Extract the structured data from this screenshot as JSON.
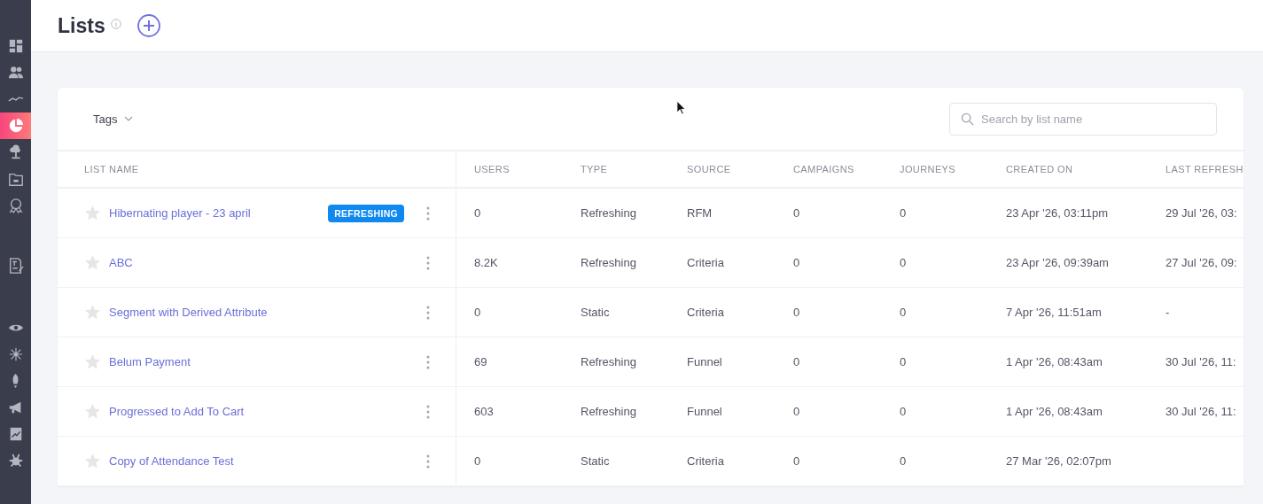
{
  "sidebar": {
    "items": [
      {
        "selected": false
      },
      {
        "selected": false
      },
      {
        "selected": false
      },
      {
        "selected": true
      },
      {
        "selected": false
      },
      {
        "selected": false
      },
      {
        "selected": false
      },
      {
        "selected": false
      },
      {
        "selected": false
      },
      {
        "selected": false
      },
      {
        "selected": false
      },
      {
        "selected": false
      },
      {
        "selected": false
      },
      {
        "selected": false
      }
    ]
  },
  "header": {
    "title": "Lists"
  },
  "toolbar": {
    "tags_label": "Tags",
    "search": {
      "placeholder": "Search by list name"
    }
  },
  "table": {
    "columns": [
      "LIST NAME",
      "USERS",
      "TYPE",
      "SOURCE",
      "CAMPAIGNS",
      "JOURNEYS",
      "CREATED ON",
      "LAST REFRESH"
    ],
    "rows": [
      {
        "starred": false,
        "badge": "REFRESHING",
        "cells": [
          "Hibernating player - 23 april",
          "0",
          "Refreshing",
          "RFM",
          "0",
          "0",
          "23 Apr '26, 03:11pm",
          "29 Jul '26, 03:"
        ]
      },
      {
        "starred": false,
        "cells": [
          "ABC",
          "8.2K",
          "Refreshing",
          "Criteria",
          "0",
          "0",
          "23 Apr '26, 09:39am",
          "27 Jul '26, 09:"
        ]
      },
      {
        "starred": false,
        "cells": [
          "Segment with Derived Attribute",
          "0",
          "Static",
          "Criteria",
          "0",
          "0",
          "7 Apr '26, 11:51am",
          "-"
        ]
      },
      {
        "starred": false,
        "cells": [
          "Belum Payment",
          "69",
          "Refreshing",
          "Funnel",
          "0",
          "0",
          "1 Apr '26, 08:43am",
          "30 Jul '26, 11:"
        ]
      },
      {
        "starred": false,
        "cells": [
          "Progressed to Add To Cart",
          "603",
          "Refreshing",
          "Funnel",
          "0",
          "0",
          "1 Apr '26, 08:43am",
          "30 Jul '26, 11:"
        ]
      },
      {
        "starred": false,
        "cells": [
          "Copy of Attendance Test",
          "0",
          "Static",
          "Criteria",
          "0",
          "0",
          "27 Mar '26, 02:07pm",
          ""
        ]
      }
    ]
  }
}
